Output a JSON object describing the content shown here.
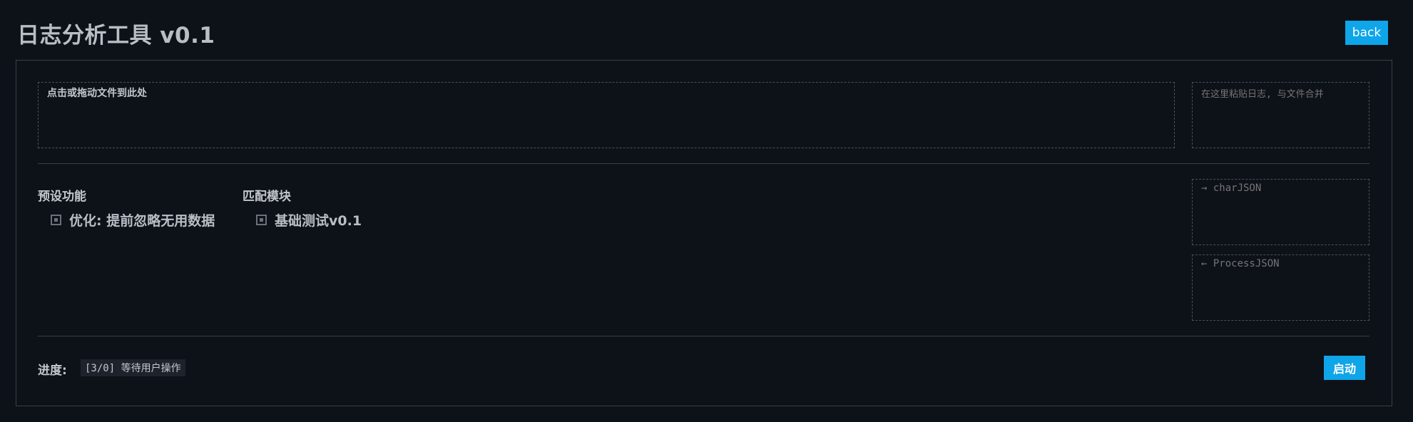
{
  "header": {
    "title": "日志分析工具 v0.1",
    "back_label": "back"
  },
  "input": {
    "dropzone_text": "点击或拖动文件到此处",
    "paste_placeholder": "在这里粘贴日志, 与文件合并"
  },
  "options": {
    "preset_heading": "预设功能",
    "preset_item": "优化: 提前忽略无用数据",
    "match_heading": "匹配模块",
    "match_item": "基础测试v0.1"
  },
  "json_io": {
    "char_placeholder": "→ charJSON",
    "process_placeholder": "← ProcessJSON"
  },
  "progress": {
    "label": "进度:",
    "status": "[3/0] 等待用户操作"
  },
  "actions": {
    "start_label": "启动"
  },
  "colors": {
    "background": "#0d1118",
    "accent": "#0ea5e9",
    "border": "#3a3f47"
  }
}
